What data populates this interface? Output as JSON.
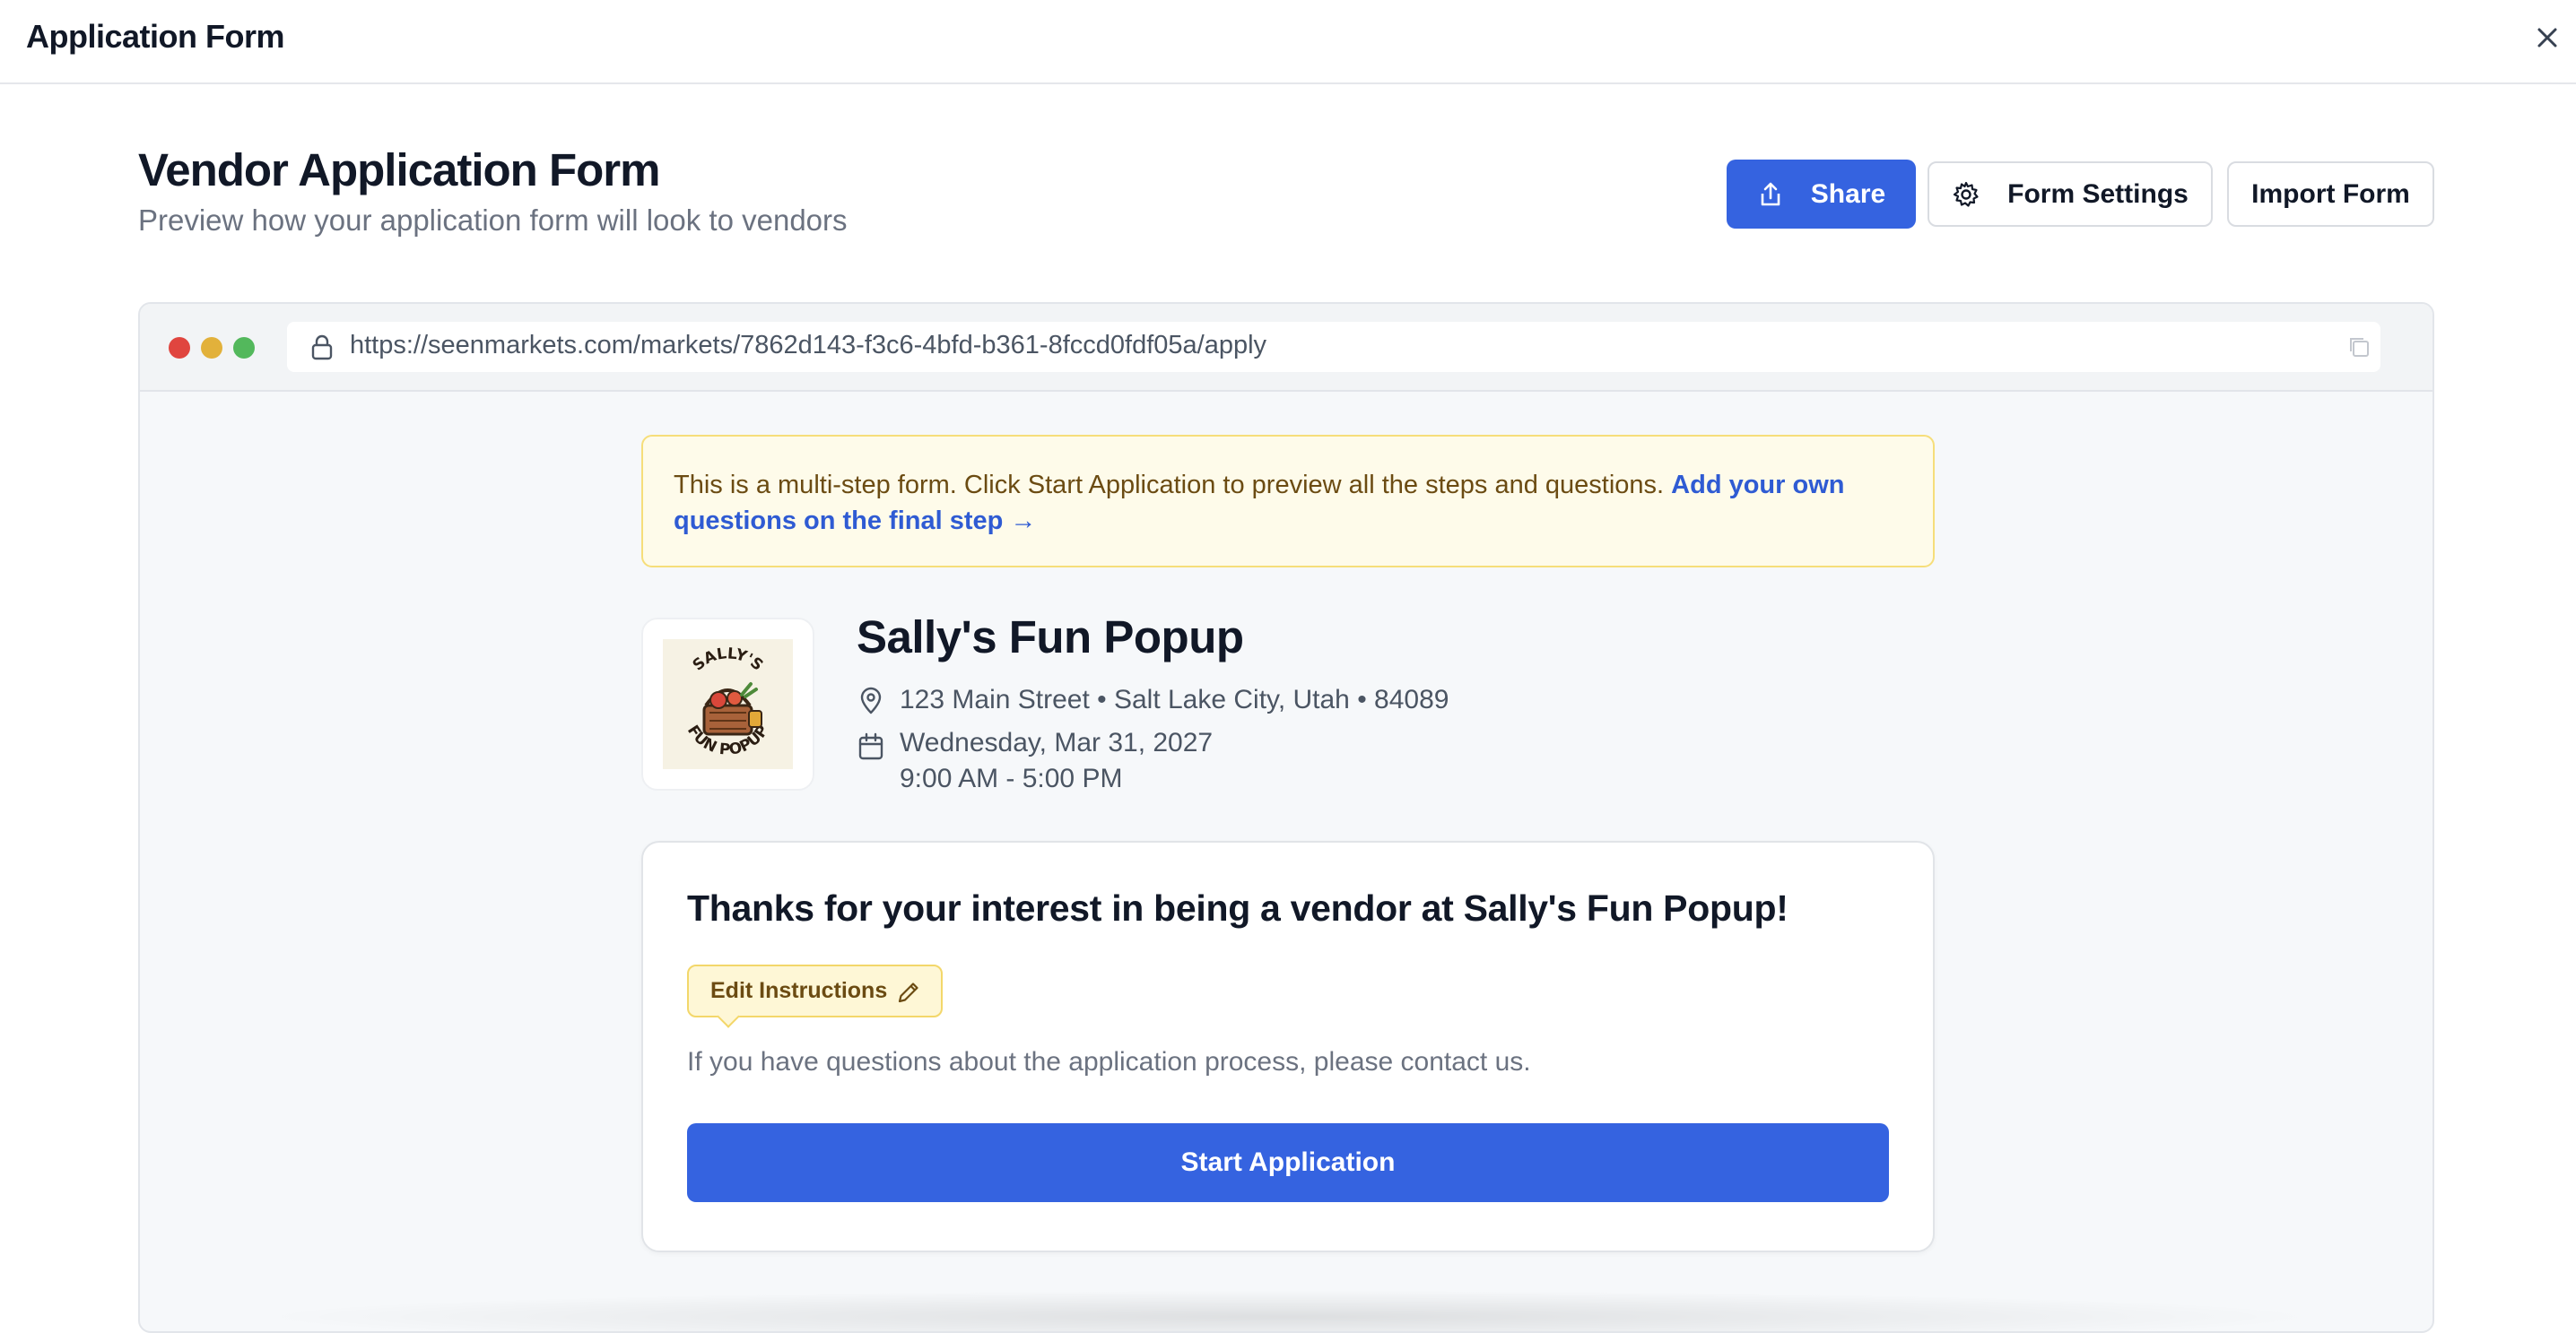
{
  "window": {
    "title": "Application Form"
  },
  "header": {
    "title": "Vendor Application Form",
    "subtitle": "Preview how your application form will look to vendors"
  },
  "toolbar": {
    "share_label": "Share",
    "settings_label": "Form Settings",
    "import_label": "Import Form"
  },
  "browser": {
    "url": "https://seenmarkets.com/markets/7862d143-f3c6-4bfd-b361-8fccd0fdf05a/apply"
  },
  "notice": {
    "text": "This is a multi-step form. Click Start Application to preview all the steps and questions. ",
    "link": "Add your own questions on the final step →"
  },
  "market": {
    "name": "Sally's Fun Popup",
    "address": "123 Main Street • Salt Lake City, Utah • 84089",
    "date": "Wednesday, Mar 31, 2027",
    "time": "9:00 AM - 5:00 PM",
    "logo_text_top": "SALLY'S",
    "logo_text_bottom": "FUN POPUP"
  },
  "card": {
    "title": "Thanks for your interest in being a vendor at Sally's Fun Popup!",
    "edit_label": "Edit Instructions",
    "body": "If you have questions about the application process, please contact us.",
    "start_label": "Start Application"
  },
  "colors": {
    "primary": "#3563e0",
    "notice_bg": "#fefbea",
    "notice_border": "#f6de7a",
    "dot_red": "#e0453f",
    "dot_yellow": "#e2b13b",
    "dot_green": "#53b85c"
  },
  "icons": [
    "close-icon",
    "share-icon",
    "gear-icon",
    "lock-icon",
    "copy-icon",
    "map-pin-icon",
    "calendar-icon",
    "pencil-icon"
  ]
}
